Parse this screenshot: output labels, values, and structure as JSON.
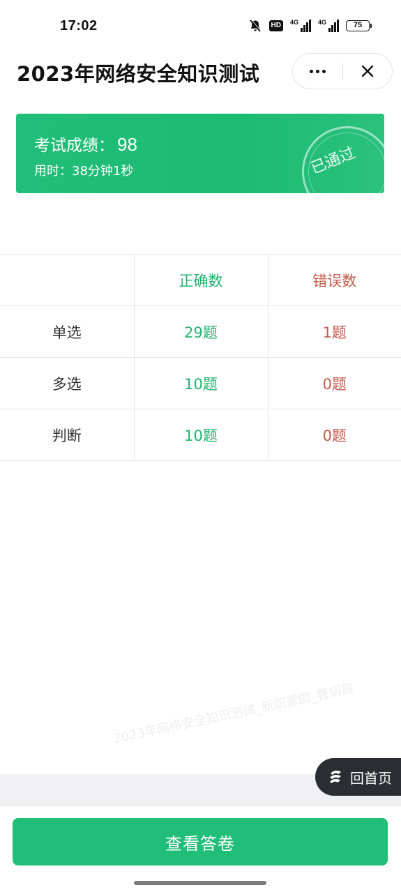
{
  "status_bar": {
    "time": "17:02",
    "hd_label": "HD",
    "network1": "4G",
    "network2": "4G",
    "battery": "75"
  },
  "header": {
    "title": "2023年网络安全知识测试"
  },
  "result": {
    "score_label": "考试成绩：",
    "score_value": "98",
    "time_label": "用时：",
    "time_value": "38分钟1秒",
    "stamp_text": "已通过"
  },
  "table": {
    "headers": [
      "",
      "正确数",
      "错误数"
    ],
    "rows": [
      {
        "type": "单选",
        "correct": "29题",
        "wrong": "1题"
      },
      {
        "type": "多选",
        "correct": "10题",
        "wrong": "0题"
      },
      {
        "type": "判断",
        "correct": "10题",
        "wrong": "0题"
      }
    ]
  },
  "watermark": "2023年网络安全知识测试_新职家园_曹娟霞",
  "home_button": {
    "label": "回首页"
  },
  "footer": {
    "view_answers_label": "查看答卷"
  },
  "colors": {
    "accent": "#20be78",
    "correct": "#21b36f",
    "wrong": "#c25a4e"
  }
}
